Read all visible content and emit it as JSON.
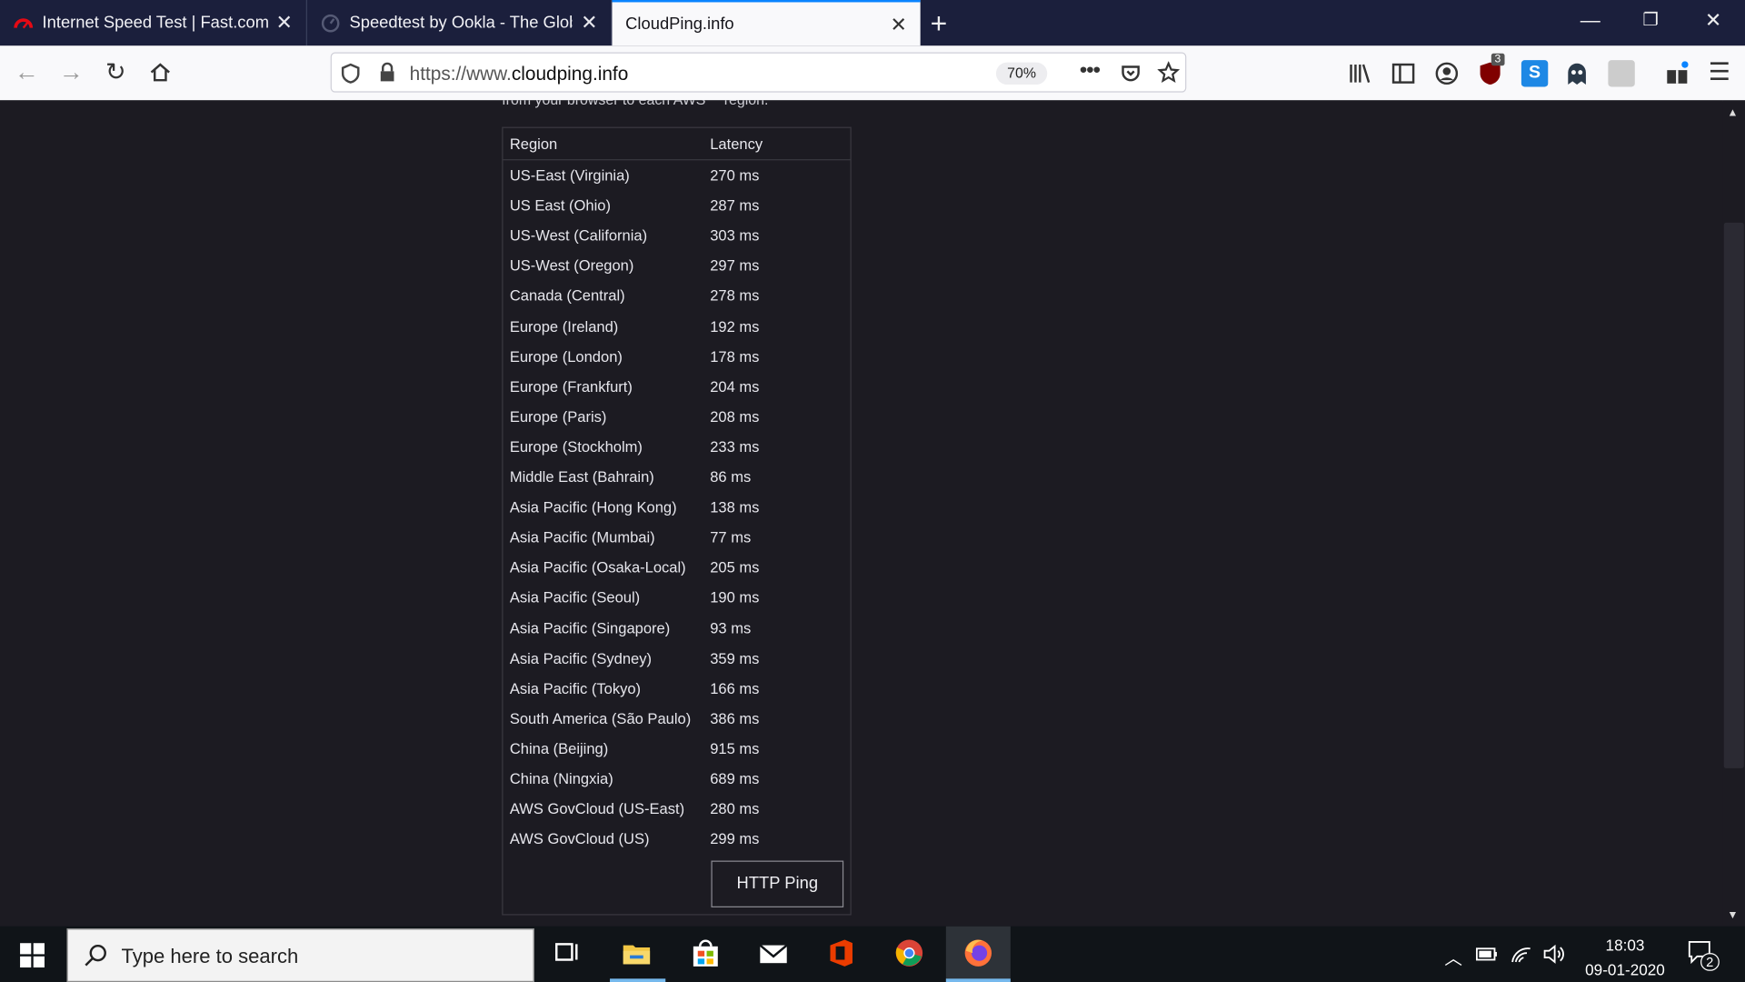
{
  "browser": {
    "tabs": [
      {
        "title": "Internet Speed Test | Fast.com",
        "active": false
      },
      {
        "title": "Speedtest by Ookla - The Global Broadband Speed Test",
        "active": false
      },
      {
        "title": "CloudPing.info",
        "active": true
      }
    ],
    "url_prefix": "https://www.",
    "url_domain": "cloudping.info",
    "zoom": "70%",
    "new_tab_icon": "plus-icon"
  },
  "extensions": {
    "ublock_count": "3"
  },
  "page": {
    "intro_text": "from your browser to each AWS™ region.",
    "table": {
      "headers": {
        "region": "Region",
        "latency": "Latency"
      },
      "rows": [
        {
          "region": "US-East (Virginia)",
          "latency": "270 ms"
        },
        {
          "region": "US East (Ohio)",
          "latency": "287 ms"
        },
        {
          "region": "US-West (California)",
          "latency": "303 ms"
        },
        {
          "region": "US-West (Oregon)",
          "latency": "297 ms"
        },
        {
          "region": "Canada (Central)",
          "latency": "278 ms"
        },
        {
          "region": "Europe (Ireland)",
          "latency": "192 ms"
        },
        {
          "region": "Europe (London)",
          "latency": "178 ms"
        },
        {
          "region": "Europe (Frankfurt)",
          "latency": "204 ms"
        },
        {
          "region": "Europe (Paris)",
          "latency": "208 ms"
        },
        {
          "region": "Europe (Stockholm)",
          "latency": "233 ms"
        },
        {
          "region": "Middle East (Bahrain)",
          "latency": "86 ms"
        },
        {
          "region": "Asia Pacific (Hong Kong)",
          "latency": "138 ms"
        },
        {
          "region": "Asia Pacific (Mumbai)",
          "latency": "77 ms"
        },
        {
          "region": "Asia Pacific (Osaka-Local)",
          "latency": "205 ms"
        },
        {
          "region": "Asia Pacific (Seoul)",
          "latency": "190 ms"
        },
        {
          "region": "Asia Pacific (Singapore)",
          "latency": "93 ms"
        },
        {
          "region": "Asia Pacific (Sydney)",
          "latency": "359 ms"
        },
        {
          "region": "Asia Pacific (Tokyo)",
          "latency": "166 ms"
        },
        {
          "region": "South America (São Paulo)",
          "latency": "386 ms"
        },
        {
          "region": "China (Beijing)",
          "latency": "915 ms"
        },
        {
          "region": "China (Ningxia)",
          "latency": "689 ms"
        },
        {
          "region": "AWS GovCloud (US-East)",
          "latency": "280 ms"
        },
        {
          "region": "AWS GovCloud (US)",
          "latency": "299 ms"
        }
      ]
    },
    "ping_button": "HTTP Ping"
  },
  "taskbar": {
    "search_placeholder": "Type here to search",
    "time": "18:03",
    "date": "09-01-2020",
    "notification_count": "2"
  },
  "colors": {
    "accent": "#0a84ff",
    "page_bg": "#1c1b22",
    "tabbar_bg": "#1b1f3c"
  }
}
